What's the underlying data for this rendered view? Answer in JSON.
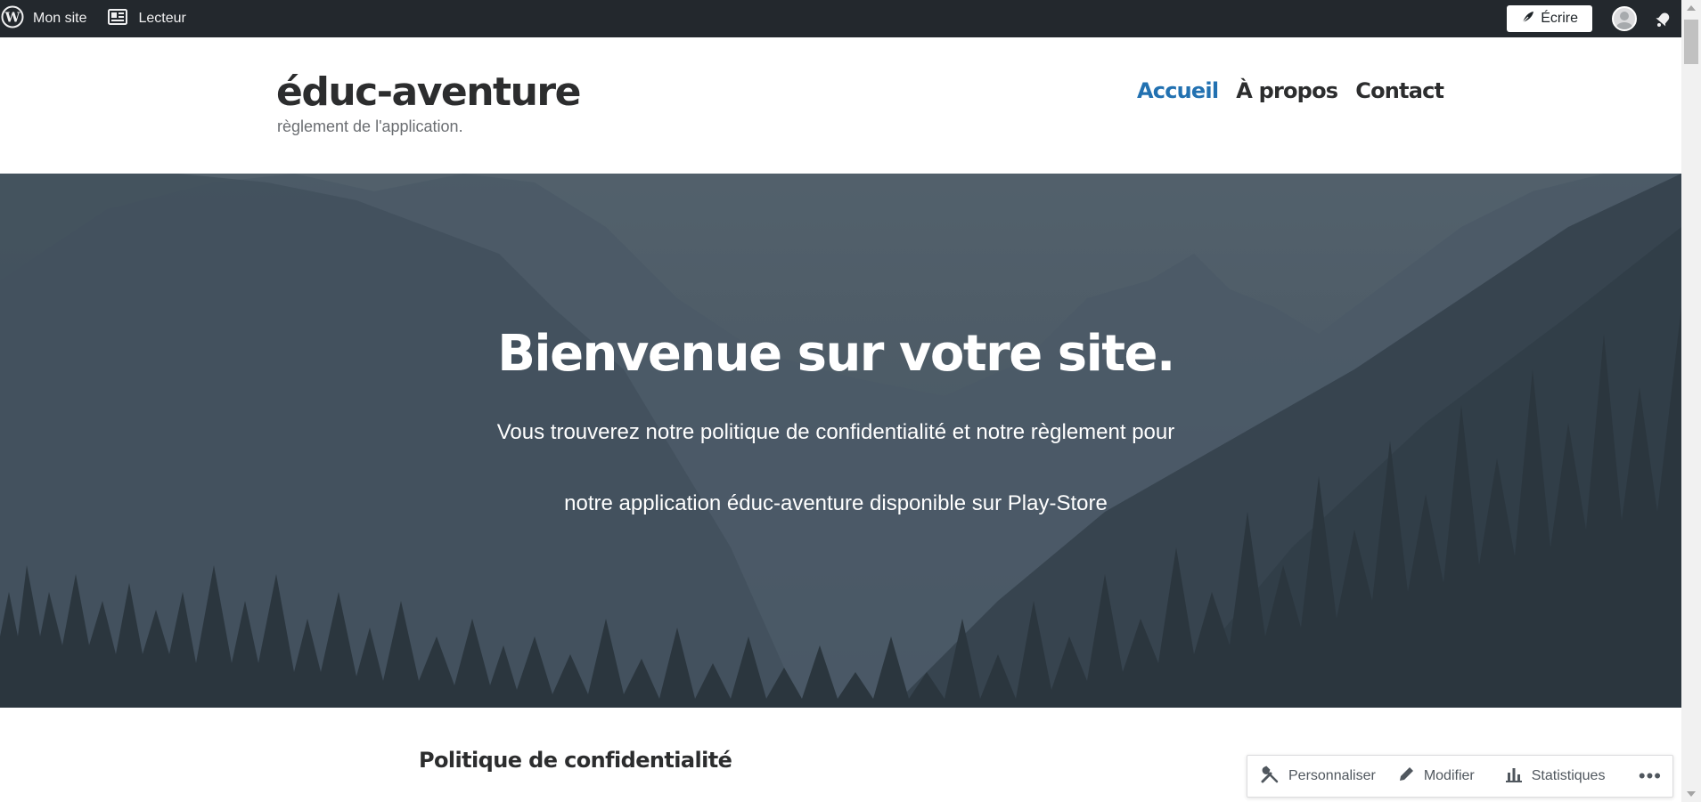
{
  "adminbar": {
    "my_site": "Mon site",
    "reader": "Lecteur",
    "write": "Écrire"
  },
  "site": {
    "title": "éduc-aventure",
    "description": "règlement de l'application."
  },
  "nav": [
    {
      "label": "Accueil",
      "active": true
    },
    {
      "label": "À propos",
      "active": false
    },
    {
      "label": "Contact",
      "active": false
    }
  ],
  "hero": {
    "title": "Bienvenue sur votre site.",
    "line1": "Vous trouverez notre politique de confidentialité et notre règlement pour",
    "line2": "notre application éduc-aventure disponible sur Play-Store"
  },
  "content": {
    "section_title": "Politique de confidentialité"
  },
  "float_toolbar": {
    "customize": "Personnaliser",
    "edit": "Modifier",
    "stats": "Statistiques",
    "more": "•••"
  },
  "colors": {
    "adminbar_bg": "#23282d",
    "accent": "#2271b1",
    "text": "#2c2d2e"
  },
  "icons": [
    "wordpress-icon",
    "reader-icon",
    "pen-icon",
    "avatar-icon",
    "bell-icon",
    "tools-icon",
    "pencil-icon",
    "bar-chart-icon",
    "more-icon"
  ]
}
